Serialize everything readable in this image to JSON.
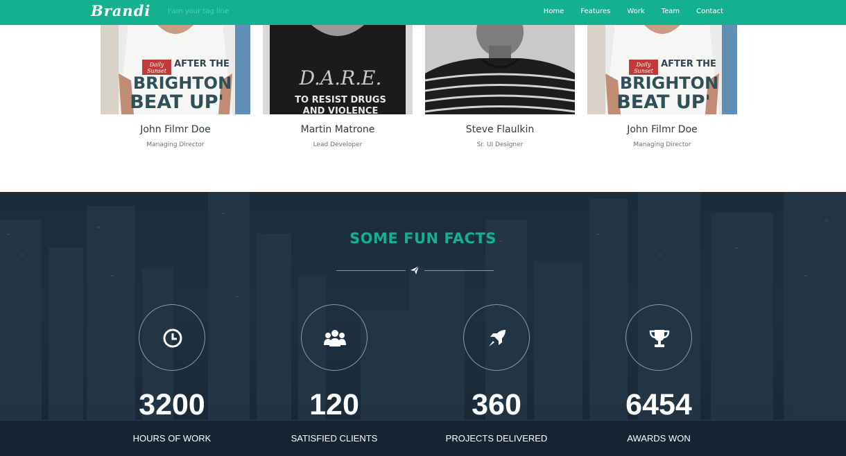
{
  "header": {
    "logo": "Brandi",
    "tagline": "I'am your tag line",
    "nav": [
      "Home",
      "Features",
      "Work",
      "Team",
      "Contact"
    ]
  },
  "team": [
    {
      "name": "John Filmr Doe",
      "role": "Managing Director",
      "photo": "shirt-brighton"
    },
    {
      "name": "Martin Matrone",
      "role": "Lead Developer",
      "photo": "shirt-dare"
    },
    {
      "name": "Steve Flaulkin",
      "role": "Sr. UI Designer",
      "photo": "striped-shirt"
    },
    {
      "name": "John Filmr Doe",
      "role": "Managing Director",
      "photo": "shirt-brighton"
    }
  ],
  "photo_text": {
    "brighton": [
      "Daily",
      "Sunset",
      "AFTER THE",
      "BRIGHTON",
      "BEAT UP'"
    ],
    "dare": [
      "D.A.R.E.",
      "TO RESIST DRUGS",
      "AND VIOLENCE"
    ]
  },
  "facts": {
    "title": "SOME FUN FACTS",
    "divider_icon": "paper-plane-icon",
    "items": [
      {
        "number": "3200",
        "label": "HOURS OF WORK",
        "icon": "clock-icon"
      },
      {
        "number": "120",
        "label": "SATISFIED CLIENTS",
        "icon": "users-icon"
      },
      {
        "number": "360",
        "label": "PROJECTS DELIVERED",
        "icon": "rocket-icon"
      },
      {
        "number": "6454",
        "label": "AWARDS WON",
        "icon": "trophy-icon"
      }
    ]
  },
  "colors": {
    "accent": "#14b190",
    "facts_bg": "#1b2c3b",
    "bottom_bar": "#142433"
  }
}
